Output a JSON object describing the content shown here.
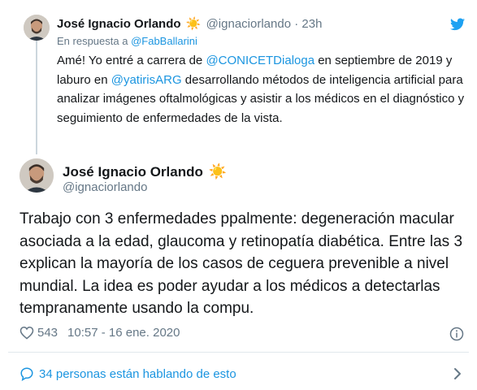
{
  "parent_tweet": {
    "author_name": "José Ignacio Orlando",
    "emoji": "☀️",
    "handle": "@ignaciorlando",
    "separator": "·",
    "time": "23h",
    "reply_prefix": "En respuesta a",
    "reply_to": "@FabBallarini",
    "text_1": "Amé! Yo entré a carrera de ",
    "mention_1": "@CONICETDialoga",
    "text_2": " en septiembre de 2019 y laburo en ",
    "mention_2": "@yatirisARG",
    "text_3": " desarrollando métodos de inteligencia artificial para analizar imágenes oftalmológicas y asistir a los médicos en el diagnóstico y seguimiento de enfermedades de la vista."
  },
  "main_tweet": {
    "author_name": "José Ignacio Orlando",
    "emoji": "☀️",
    "handle": "@ignaciorlando",
    "text": "Trabajo con 3 enfermedades ppalmente: degeneración macular asociada a la edad, glaucoma y retinopatía diabética. Entre las 3 explican la mayoría de los casos de ceguera prevenible a nivel mundial. La idea es poder ayudar a los médicos a detectarlas tempranamente usando la compu.",
    "likes": "543",
    "timestamp": "10:57 - 16 ene. 2020"
  },
  "conversation": {
    "label": "34 personas están hablando de esto"
  },
  "icons": {
    "brand": "twitter-bird-icon",
    "like": "heart-icon",
    "info": "info-icon",
    "reply": "speech-bubble-icon",
    "chevron": "chevron-right-icon"
  },
  "colors": {
    "link": "#1b95e0",
    "muted": "#657786",
    "text": "#14171a",
    "sun": "#ff9a00",
    "divider": "#e1e8ed"
  }
}
